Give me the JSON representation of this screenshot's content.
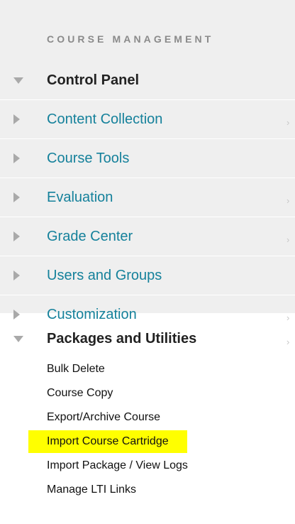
{
  "section_title": "COURSE MANAGEMENT",
  "control_panel": {
    "title": "Control Panel",
    "items": [
      {
        "label": "Content Collection",
        "chevron": "›"
      },
      {
        "label": "Course Tools"
      },
      {
        "label": "Evaluation",
        "chevron": "›"
      },
      {
        "label": "Grade Center",
        "chevron": "›"
      },
      {
        "label": "Users and Groups"
      },
      {
        "label": "Customization",
        "chevron": "›"
      }
    ]
  },
  "packages": {
    "title": "Packages and Utilities",
    "chevron": "›",
    "subitems": [
      {
        "label": "Bulk Delete"
      },
      {
        "label": "Course Copy"
      },
      {
        "label": "Export/Archive Course"
      },
      {
        "label": "Import Course Cartridge",
        "highlighted": true
      },
      {
        "label": "Import Package / View Logs"
      },
      {
        "label": "Manage LTI Links"
      }
    ]
  },
  "colors": {
    "link": "#15819b",
    "highlight": "#ffff00",
    "panel_bg": "#efefef",
    "arrow": "#a9a9a9"
  },
  "icons": {
    "expanded": "triangle-down-icon",
    "collapsed": "triangle-right-icon",
    "chevron": "chevron-right-icon"
  }
}
